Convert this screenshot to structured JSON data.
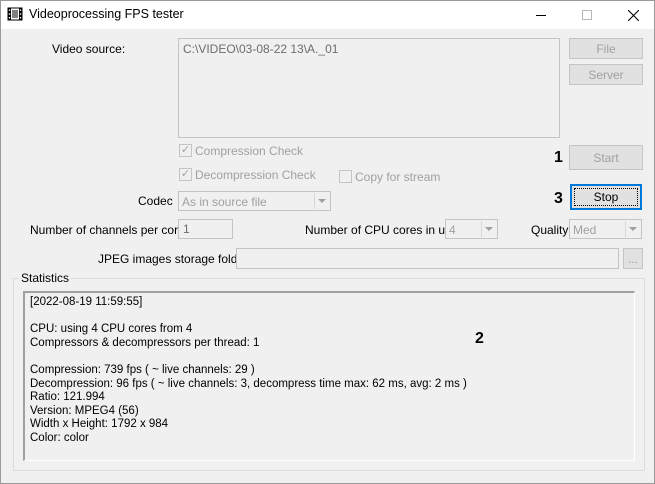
{
  "window": {
    "title": "Videoprocessing FPS tester",
    "minimize_icon": "minimize-icon",
    "maximize_icon": "maximize-icon",
    "close_icon": "close-icon"
  },
  "source": {
    "label": "Video source:",
    "value": "C:\\VIDEO\\03-08-22 13\\A._01",
    "file_button": "File",
    "server_button": "Server"
  },
  "checks": {
    "compression": "Compression Check",
    "decompression": "Decompression Check",
    "copy_for_stream": "Copy for stream",
    "compression_checked": true,
    "decompression_checked": true,
    "copy_for_stream_checked": false
  },
  "buttons": {
    "start": "Start",
    "stop": "Stop"
  },
  "markers": {
    "one": "1",
    "two": "2",
    "three": "3"
  },
  "codec": {
    "label": "Codec",
    "value": "As in source file"
  },
  "channels": {
    "label": "Number of channels per core",
    "value": "1"
  },
  "cpu": {
    "label": "Number of CPU cores in use",
    "value": "4"
  },
  "quality": {
    "label": "Quality",
    "value": "Med"
  },
  "jpeg": {
    "label": "JPEG images storage folder",
    "value": "",
    "browse_button": "..."
  },
  "statistics": {
    "title": "Statistics",
    "lines": [
      "[2022-08-19 11:59:55]",
      "",
      "CPU: using 4 CPU cores from 4",
      "Compressors & decompressors per thread: 1",
      "",
      "Compression: 739 fps ( ~ live channels: 29 )",
      "Decompression: 96 fps ( ~ live channels: 3, decompress time max: 62 ms, avg: 2 ms )",
      "Ratio: 121.994",
      "Version: MPEG4 (56)",
      "Width x Height: 1792 x 984",
      "Color: color"
    ]
  }
}
